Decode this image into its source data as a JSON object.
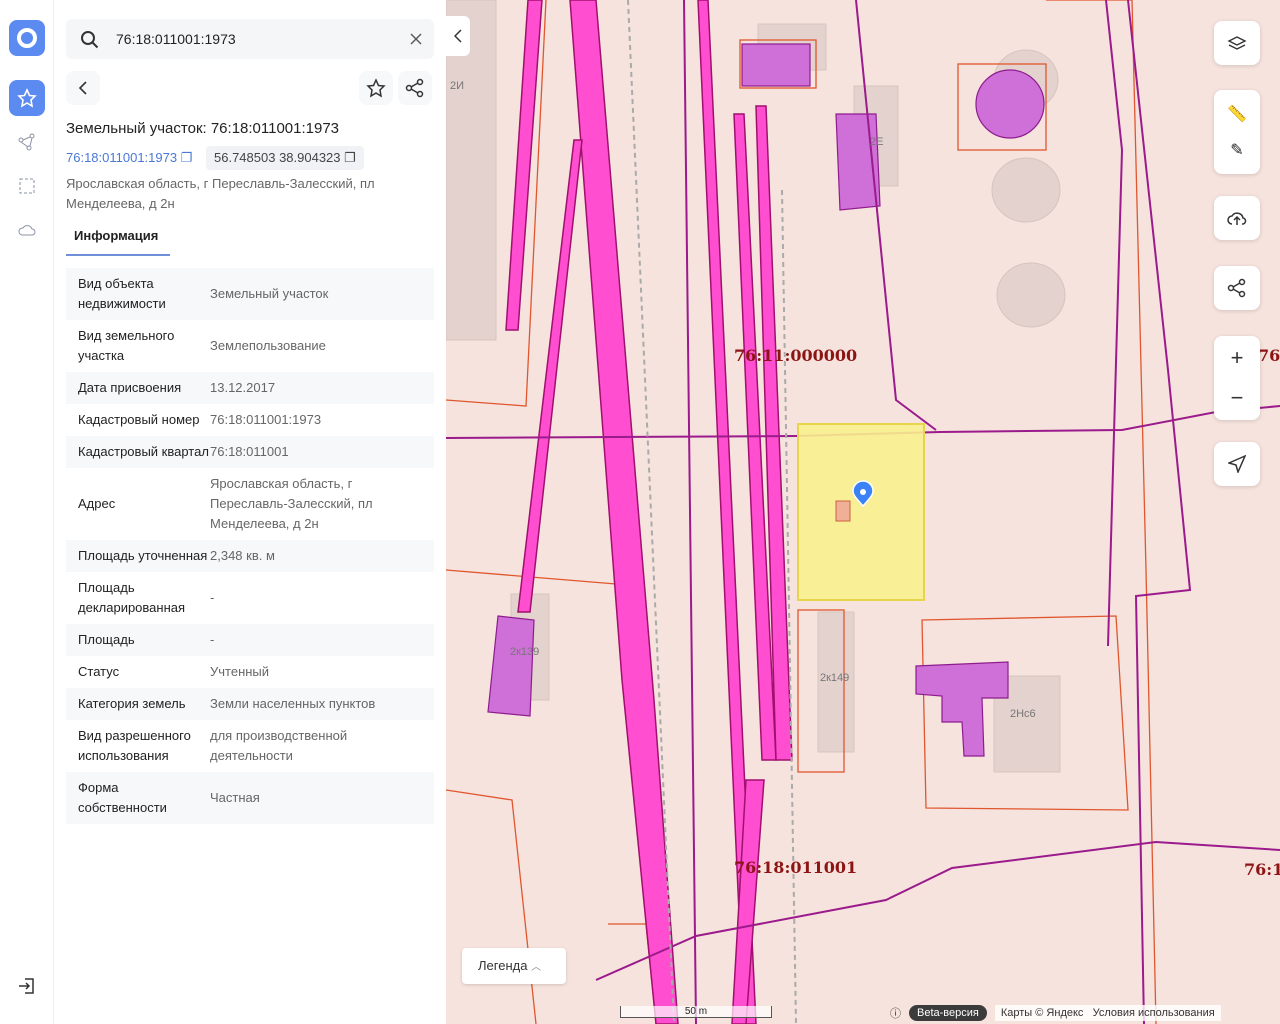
{
  "search": {
    "value": "76:18:011001:1973"
  },
  "card": {
    "title": "Земельный участок: 76:18:011001:1973",
    "cad_link": "76:18:011001:1973",
    "coords": "56.748503 38.904323",
    "address": "Ярославская область, г Переславль-Залесский, пл Менделеева, д 2н",
    "tab": "Информация"
  },
  "rows": [
    {
      "k": "Вид объекта недвижимости",
      "v": "Земельный участок"
    },
    {
      "k": "Вид земельного участка",
      "v": "Землепользование"
    },
    {
      "k": "Дата присвоения",
      "v": "13.12.2017"
    },
    {
      "k": "Кадастровый номер",
      "v": "76:18:011001:1973"
    },
    {
      "k": "Кадастровый квартал",
      "v": "76:18:011001"
    },
    {
      "k": "Адрес",
      "v": "Ярославская область, г Переславль-Залесский, пл Менделеева, д 2н"
    },
    {
      "k": "Площадь уточненная",
      "v": "2,348 кв. м"
    },
    {
      "k": "Площадь декларированная",
      "v": "-"
    },
    {
      "k": "Площадь",
      "v": "-"
    },
    {
      "k": "Статус",
      "v": "Учтенный"
    },
    {
      "k": "Категория земель",
      "v": "Земли населенных пунктов"
    },
    {
      "k": "Вид разрешенного использования",
      "v": "для производственной деятельности"
    },
    {
      "k": "Форма собственности",
      "v": "Частная"
    }
  ],
  "map": {
    "labels": [
      "76:11:000000",
      "76:18:011001",
      "76:1",
      "76:1"
    ],
    "buildings": [
      "2И",
      "2Е",
      "2к139",
      "2к149",
      "2Нс6"
    ],
    "legend": "Легенда",
    "scale": "50 m",
    "beta": "Beta-версия",
    "attribution": "Карты © Яндекс",
    "terms": "Условия использования"
  },
  "colors": {
    "accent": "#5b8af0",
    "parcel": "#f5ef8a",
    "zone": "#ff44cc"
  }
}
